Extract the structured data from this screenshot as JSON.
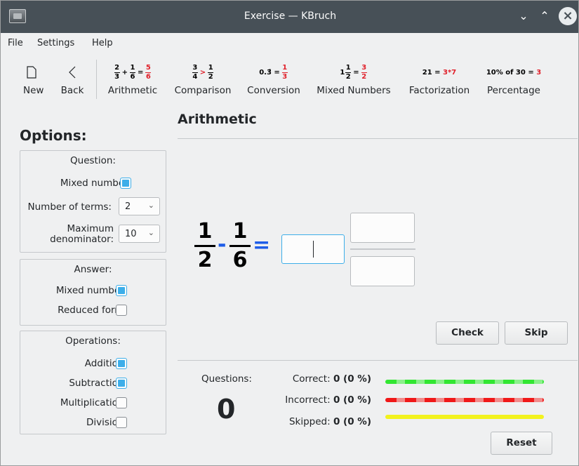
{
  "window": {
    "title": "Exercise — KBruch",
    "minimize_icon": "chevron-down-icon",
    "maximize_icon": "chevron-up-icon",
    "close_icon": "close-icon"
  },
  "menubar": {
    "file": "File",
    "settings": "Settings",
    "help": "Help"
  },
  "toolbar": {
    "new_label": "New",
    "back_label": "Back",
    "arithmetic_label": "Arithmetic",
    "comparison_label": "Comparison",
    "conversion_label": "Conversion",
    "mixed_numbers_label": "Mixed Numbers",
    "factorization_label": "Factorization",
    "percentage_label": "Percentage",
    "arith_icon": {
      "a_num": "2",
      "a_den": "3",
      "op": "+",
      "b_num": "1",
      "b_den": "6",
      "eq": "=",
      "r_num": "5",
      "r_den": "6"
    },
    "comp_icon": {
      "a_num": "3",
      "a_den": "4",
      "op": ">",
      "b_num": "1",
      "b_den": "2"
    },
    "conv_icon": {
      "left": "0.3̄ =",
      "r_num": "1",
      "r_den": "3"
    },
    "mixed_icon": {
      "whole": "1",
      "a_num": "1",
      "a_den": "2",
      "eq": "=",
      "r_num": "3",
      "r_den": "2"
    },
    "fact_icon": {
      "left": "21 = ",
      "right": "3*7"
    },
    "perc_icon": {
      "left": "10% of 30 = ",
      "right": "3"
    }
  },
  "options": {
    "title": "Options:",
    "question": {
      "title": "Question:",
      "mixed_number_label": "Mixed number:",
      "mixed_number_checked": true,
      "num_terms_label": "Number of terms:",
      "num_terms_value": "2",
      "max_den_label_1": "Maximum",
      "max_den_label_2": "denominator:",
      "max_den_value": "10"
    },
    "answer": {
      "title": "Answer:",
      "mixed_number_label": "Mixed number:",
      "mixed_number_checked": true,
      "reduced_label": "Reduced form:",
      "reduced_checked": false
    },
    "operations": {
      "title": "Operations:",
      "addition": "Addition:",
      "subtraction": "Subtraction:",
      "multiplication": "Multiplication:",
      "division": "Division:"
    }
  },
  "exercise": {
    "title": "Arithmetic",
    "frac1_num": "1",
    "frac1_den": "2",
    "operator": "-",
    "frac2_num": "1",
    "frac2_den": "6",
    "equals": "=",
    "check_label": "Check",
    "skip_label": "Skip"
  },
  "stats": {
    "questions_label": "Questions:",
    "questions_count": "0",
    "correct_label": "Correct:",
    "correct_value": "0 (0 %)",
    "incorrect_label": "Incorrect:",
    "incorrect_value": "0 (0 %)",
    "skipped_label": "Skipped:",
    "skipped_value": "0 (0 %)",
    "reset_label": "Reset",
    "colors": {
      "correct": "#3ae03a",
      "incorrect": "#f01818",
      "skipped": "#f2f21e"
    }
  }
}
